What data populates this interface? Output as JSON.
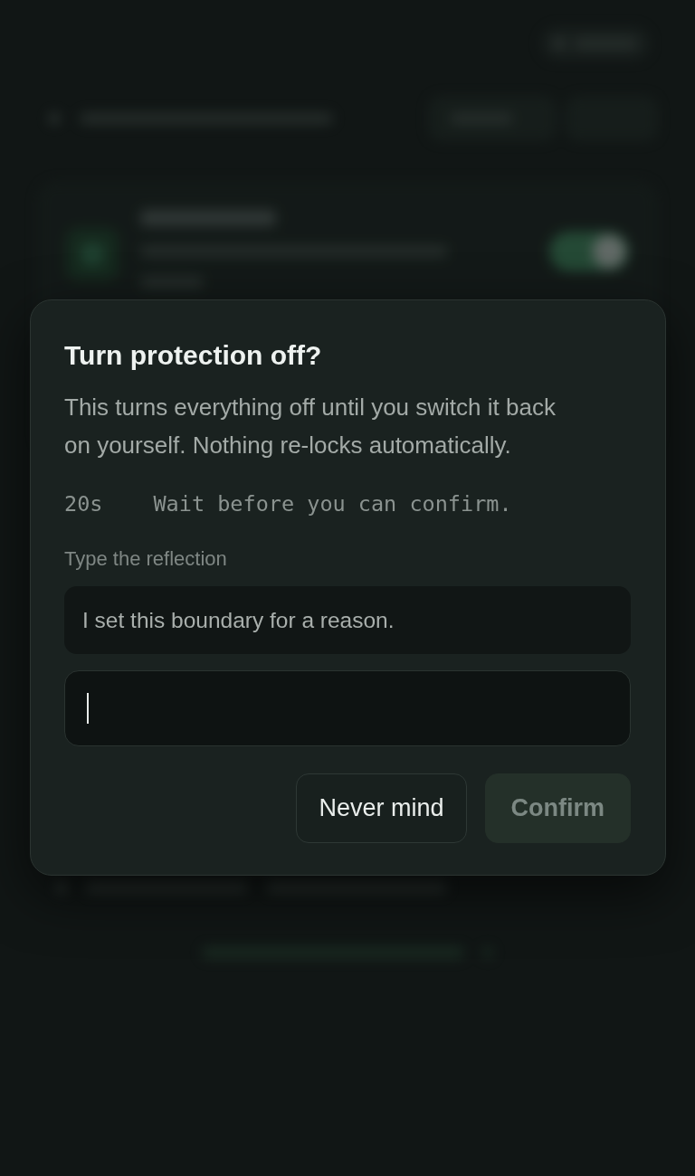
{
  "dialog": {
    "title": "Turn protection off?",
    "message": "This turns everything off until you switch it back on yourself. Nothing re-locks automatically.",
    "countdown": {
      "value": "20s",
      "text": "Wait before you can confirm."
    },
    "reflection": {
      "label": "Type the reflection",
      "phrase": "I set this boundary for a reason.",
      "input": {
        "focused": true
      }
    },
    "buttons": [
      {
        "label": "Never mind",
        "kind": "secondary",
        "disabled": false
      },
      {
        "label": "Confirm",
        "kind": "primary",
        "disabled": true
      }
    ]
  }
}
